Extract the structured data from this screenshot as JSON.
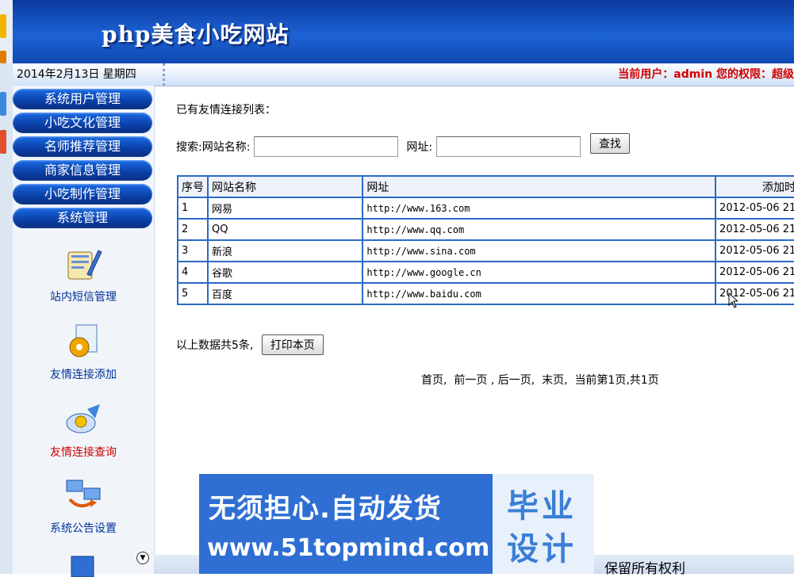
{
  "header": {
    "title": "php美食小吃网站"
  },
  "infobar": {
    "date": "2014年2月13日 星期四",
    "user_info": "当前用户：admin 您的权限：超级"
  },
  "sidebar": {
    "menu": [
      {
        "label": "系统用户管理"
      },
      {
        "label": "小吃文化管理"
      },
      {
        "label": "名师推荐管理"
      },
      {
        "label": "商家信息管理"
      },
      {
        "label": "小吃制作管理"
      },
      {
        "label": "系统管理"
      }
    ],
    "tools": [
      {
        "label": "站内短信管理",
        "icon": "message-edit-icon"
      },
      {
        "label": "友情连接添加",
        "icon": "link-settings-icon"
      },
      {
        "label": "友情连接查询",
        "icon": "link-query-icon"
      },
      {
        "label": "系统公告设置",
        "icon": "network-announce-icon"
      }
    ]
  },
  "main": {
    "list_title": "已有友情连接列表：",
    "search": {
      "label_name": "搜索:网站名称:",
      "name_value": "",
      "label_url": "网址:",
      "url_value": "",
      "button": "查找"
    },
    "table": {
      "headers": [
        "序号",
        "网站名称",
        "网址",
        "添加时间"
      ],
      "rows": [
        [
          "1",
          "网易",
          "http://www.163.com",
          "2012-05-06 21"
        ],
        [
          "2",
          "QQ",
          "http://www.qq.com",
          "2012-05-06 21"
        ],
        [
          "3",
          "新浪",
          "http://www.sina.com",
          "2012-05-06 21"
        ],
        [
          "4",
          "谷歌",
          "http://www.google.cn",
          "2012-05-06 21"
        ],
        [
          "5",
          "百度",
          "http://www.baidu.com",
          "2012-05-06 21"
        ]
      ]
    },
    "total_text": "以上数据共5条,",
    "print_button": "打印本页",
    "pager": {
      "first": "首页,",
      "prev": "前一页",
      "sep": ",",
      "next": "后一页,",
      "last": "末页,",
      "status": "当前第1页,共1页"
    }
  },
  "footer": {
    "copyright": "保留所有权利"
  },
  "promo": {
    "line1": "无须担心.自动发货",
    "line2": "www.51topmind.com",
    "seal_top": "毕业",
    "seal_bottom": "设计"
  },
  "colors": {
    "header_blue": "#1d63d6",
    "menu_blue": "#0a3fa7",
    "table_border": "#2a6bc7",
    "user_info_red": "#d00000",
    "active_tool_red": "#cc0000"
  }
}
